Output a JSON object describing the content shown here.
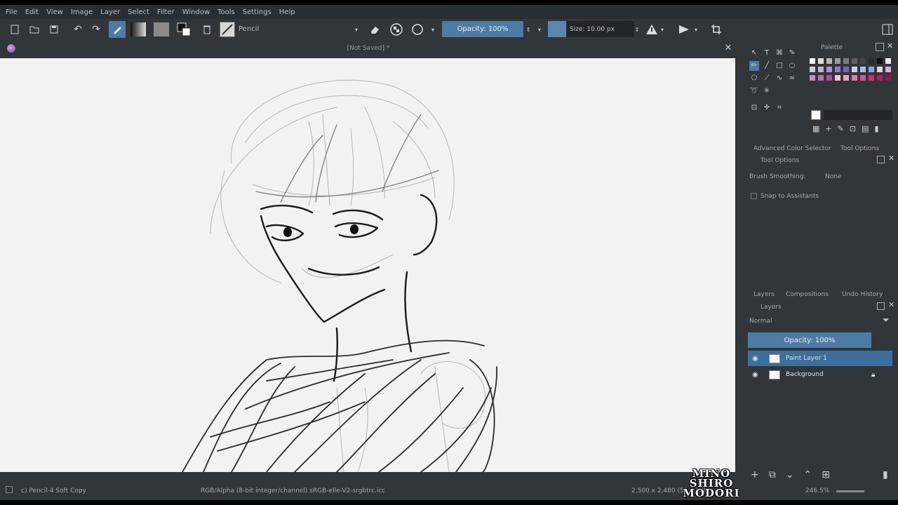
{
  "menu": [
    "File",
    "Edit",
    "View",
    "Image",
    "Layer",
    "Select",
    "Filter",
    "Window",
    "Tools",
    "Settings",
    "Help"
  ],
  "toolbar": {
    "preset_name": "Pencil",
    "opacity_label": "Opacity: 100%",
    "size_label": "Size: 10.00 px"
  },
  "document": {
    "title": "[Not Saved] *"
  },
  "palette": {
    "title": "Palette",
    "colors": [
      "#f7f7f7",
      "#dcdcdc",
      "#b9b9b9",
      "#9b9b9b",
      "#7c7c7c",
      "#5e5e5e",
      "#444444",
      "#2a2a2a",
      "#111111",
      "#e9e6f2",
      "#d3cde6",
      "#bdb3dc",
      "#a699d1",
      "#8e80c4",
      "#7767b7",
      "#c7d4f2",
      "#a8bde8",
      "#8aa6df",
      "#e8d0e6",
      "#d9b0d4",
      "#c98fc2",
      "#b86eaf",
      "#a84f9c",
      "#f3c6d9",
      "#ec9fc0",
      "#e478a8",
      "#dc528f",
      "#d42c76",
      "#c21466",
      "#9c0e50"
    ]
  },
  "tool_options": {
    "tabs": [
      "Advanced Color Selector",
      "Tool Options"
    ],
    "title": "Tool Options",
    "snap_label": "Brush Smoothing:",
    "snap_value": "None",
    "assistant_label": "Snap to Assistants"
  },
  "layers": {
    "tabs": [
      "Layers",
      "Compositions",
      "Undo History"
    ],
    "title": "Layers",
    "blend_mode": "Normal",
    "opacity_label": "Opacity: 100%",
    "items": [
      {
        "name": "Paint Layer 1",
        "active": true
      },
      {
        "name": "Background",
        "active": false
      }
    ]
  },
  "status": {
    "brush": "c) Pencil-4 Soft Copy",
    "color_space": "RGB/Alpha (8-bit integer/channel)  sRGB-elle-V2-srgbtrc.icc",
    "dimensions": "2,500 x 2,480 (50.8 MB)",
    "zoom": "246.5%"
  },
  "watermark": [
    "MINO",
    "SHIRO",
    "MODORI"
  ]
}
